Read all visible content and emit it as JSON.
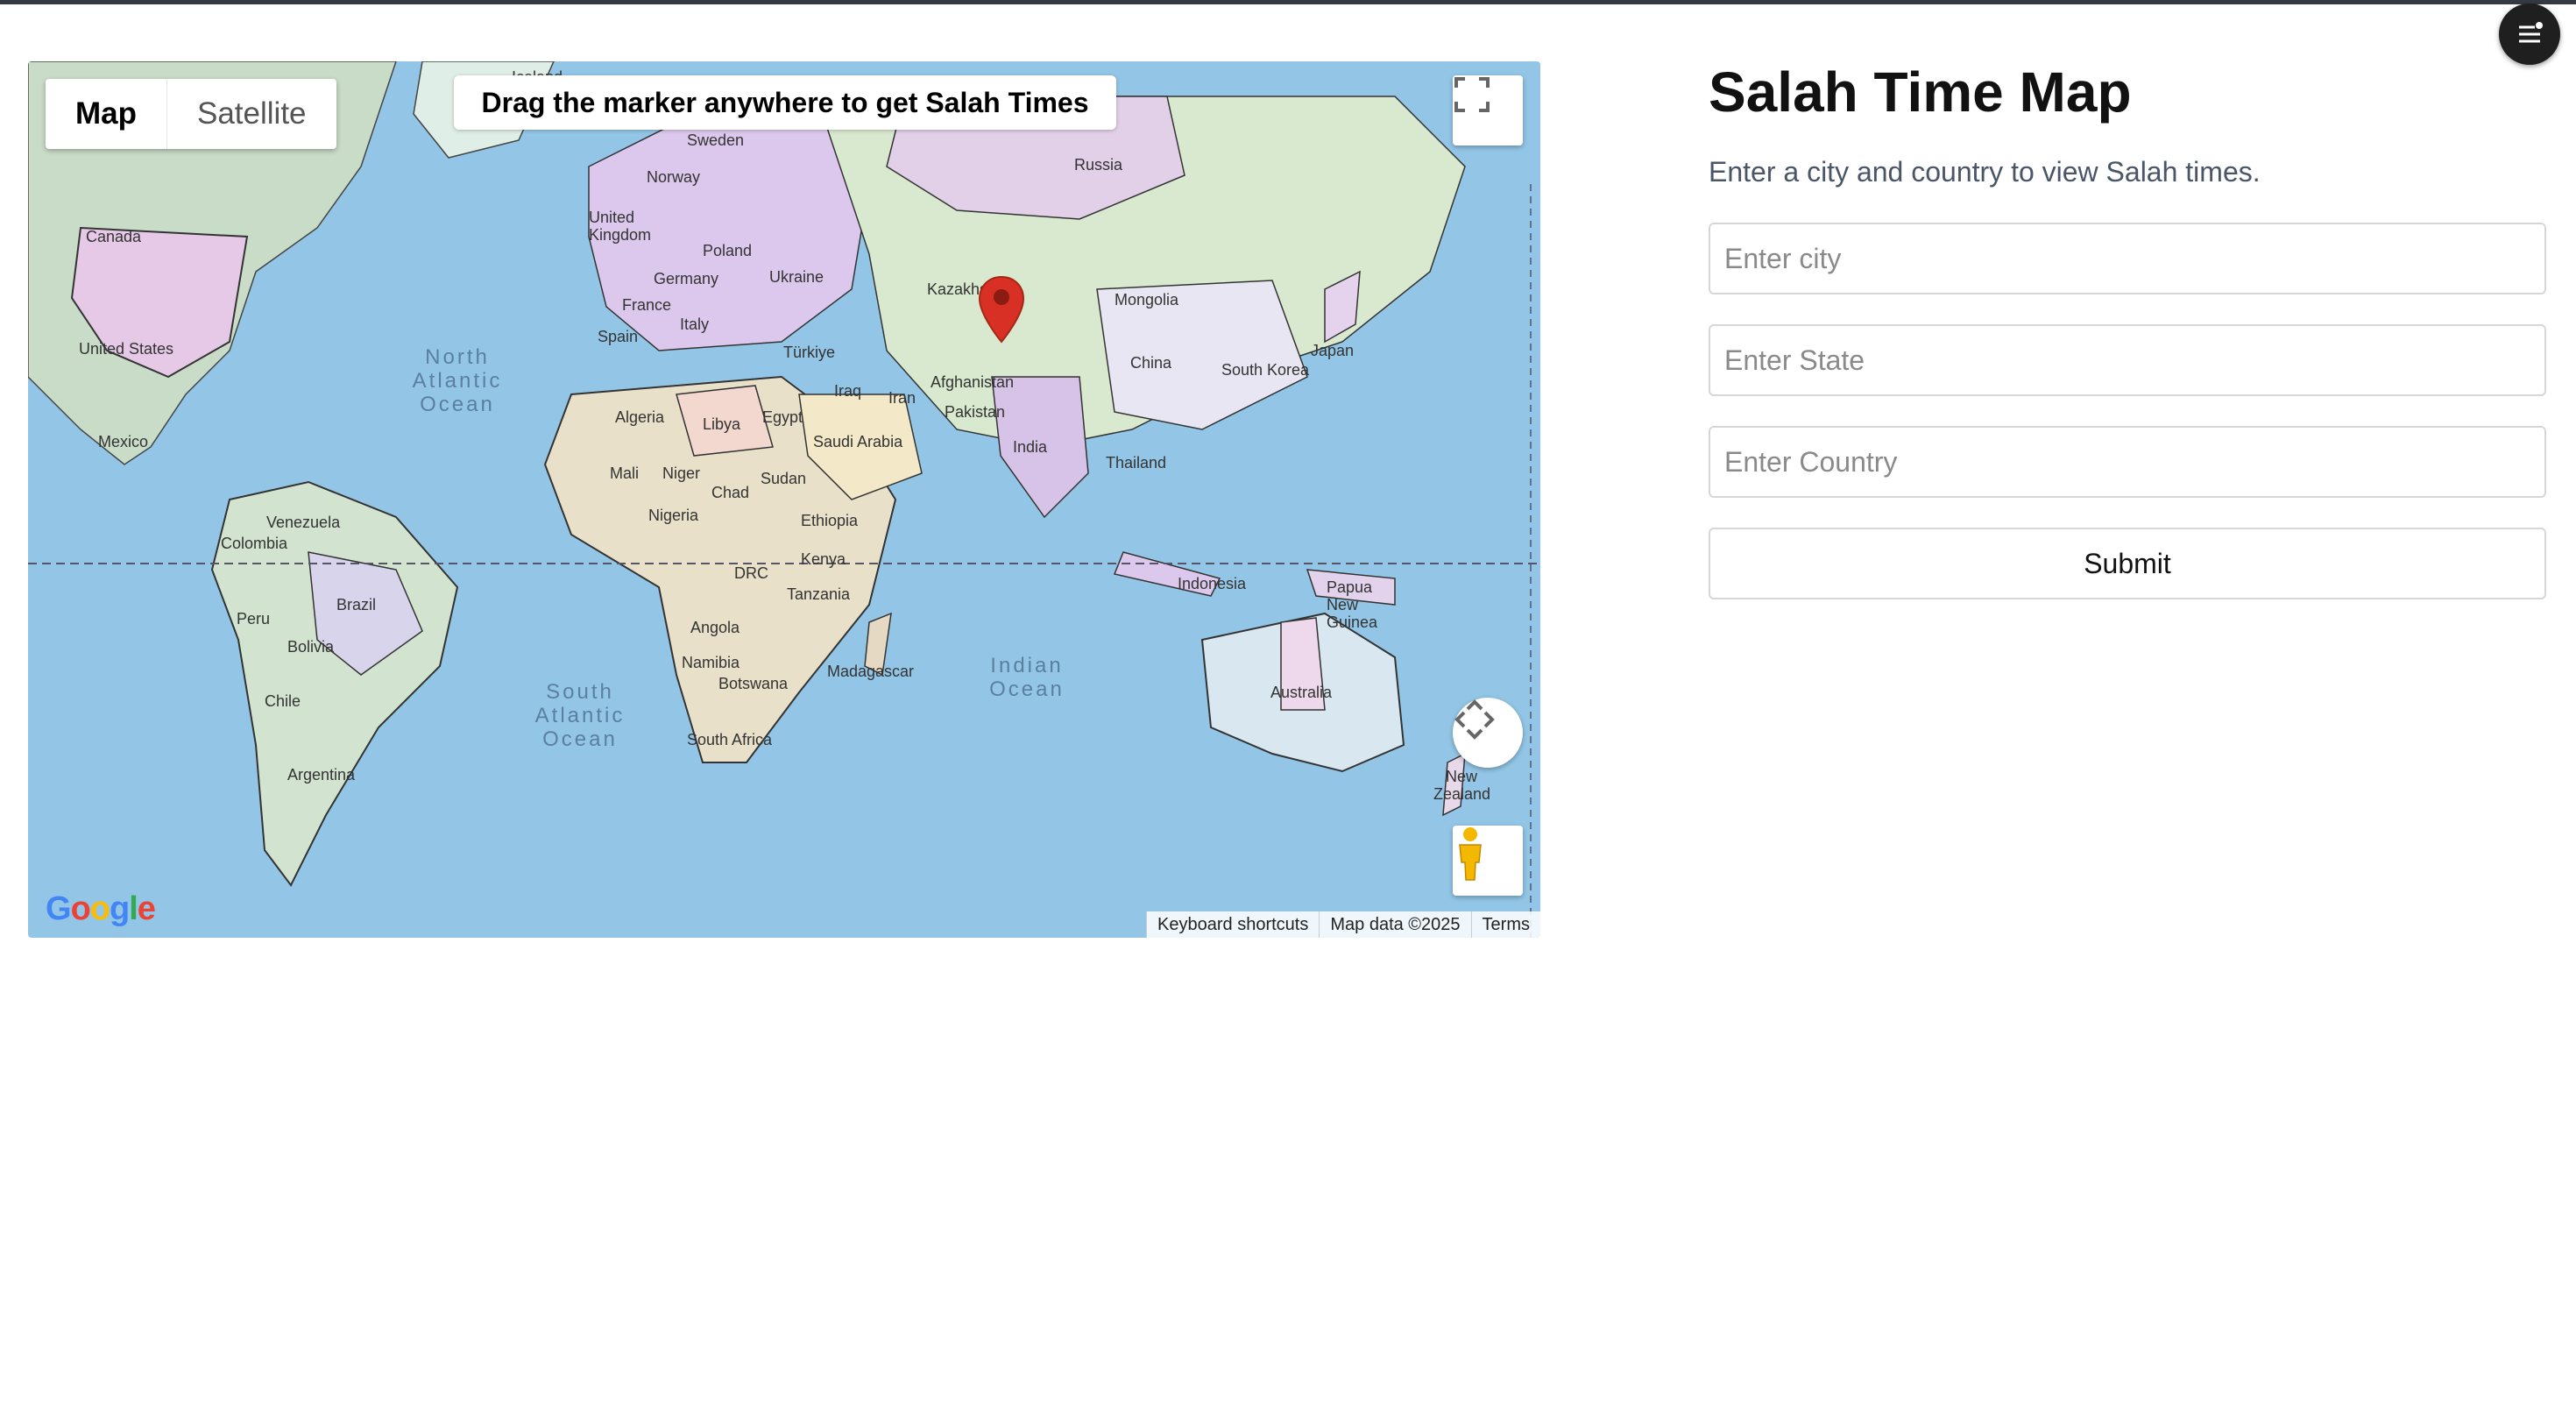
{
  "map": {
    "type_control": {
      "map_label": "Map",
      "satellite_label": "Satellite"
    },
    "banner": "Drag the marker anywhere to get Salah Times",
    "attribution": {
      "shortcuts": "Keyboard shortcuts",
      "data": "Map data ©2025",
      "terms": "Terms"
    },
    "logo_text": "Google",
    "labels": [
      "Iceland",
      "Sweden",
      "Norway",
      "Russia",
      "Canada",
      "United Kingdom",
      "Poland",
      "Ukraine",
      "Germany",
      "France",
      "Italy",
      "Spain",
      "Kazakhstan",
      "Mongolia",
      "United States",
      "Türkiye",
      "Japan",
      "China",
      "South Korea",
      "Iraq",
      "Iran",
      "Afghanistan",
      "Pakistan",
      "Algeria",
      "Libya",
      "Egypt",
      "Saudi Arabia",
      "Mexico",
      "India",
      "Thailand",
      "Mali",
      "Niger",
      "Chad",
      "Sudan",
      "Nigeria",
      "Ethiopia",
      "Venezuela",
      "Colombia",
      "Kenya",
      "DRC",
      "Tanzania",
      "Indonesia",
      "Papua New Guinea",
      "Brazil",
      "Peru",
      "Angola",
      "Bolivia",
      "Namibia",
      "Botswana",
      "Madagascar",
      "Australia",
      "Chile",
      "South Africa",
      "Argentina",
      "New Zealand"
    ],
    "oceans": [
      "North Atlantic Ocean",
      "South Atlantic Ocean",
      "Indian Ocean"
    ],
    "colors": {
      "ocean": "#93c6e6",
      "marker": "#d93025"
    }
  },
  "page": {
    "title": "Salah Time Map",
    "subtitle": "Enter a city and country to view Salah times.",
    "form": {
      "city_placeholder": "Enter city",
      "state_placeholder": "Enter State",
      "country_placeholder": "Enter Country",
      "submit_label": "Submit"
    }
  },
  "icons": [
    "fullscreen-icon",
    "camera-control-icon",
    "pegman-icon",
    "map-marker-icon",
    "menu-icon"
  ]
}
